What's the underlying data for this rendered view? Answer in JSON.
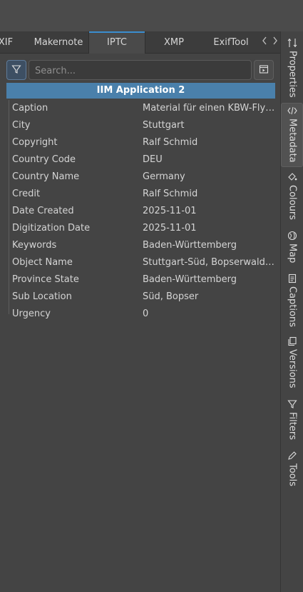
{
  "tabs": [
    {
      "label": "XIF",
      "active": false
    },
    {
      "label": "Makernote",
      "active": false
    },
    {
      "label": "IPTC",
      "active": true
    },
    {
      "label": "XMP",
      "active": false
    },
    {
      "label": "ExifTool",
      "active": false
    }
  ],
  "search": {
    "placeholder": "Search..."
  },
  "section_header": "IIM Application 2",
  "rows": [
    {
      "key": "Caption",
      "value": "Material für einen KBW-Flyer..."
    },
    {
      "key": "City",
      "value": "Stuttgart"
    },
    {
      "key": "Copyright",
      "value": "Ralf Schmid"
    },
    {
      "key": "Country Code",
      "value": "DEU"
    },
    {
      "key": "Country Name",
      "value": "Germany"
    },
    {
      "key": "Credit",
      "value": "Ralf Schmid"
    },
    {
      "key": "Date Created",
      "value": "2025-11-01"
    },
    {
      "key": "Digitization Date",
      "value": "2025-11-01"
    },
    {
      "key": "Keywords",
      "value": "Baden-Württemberg"
    },
    {
      "key": "Object Name",
      "value": "Stuttgart-Süd, Bopserwaldstr..."
    },
    {
      "key": "Province State",
      "value": "Baden-Württemberg"
    },
    {
      "key": "Sub Location",
      "value": "Süd, Bopser"
    },
    {
      "key": "Urgency",
      "value": "0"
    }
  ],
  "sidebar": [
    {
      "label": "Properties",
      "icon": "properties-icon",
      "active": false
    },
    {
      "label": "Metadata",
      "icon": "code-icon",
      "active": true
    },
    {
      "label": "Colours",
      "icon": "paint-bucket-icon",
      "active": false
    },
    {
      "label": "Map",
      "icon": "globe-icon",
      "active": false
    },
    {
      "label": "Captions",
      "icon": "document-icon",
      "active": false
    },
    {
      "label": "Versions",
      "icon": "versions-icon",
      "active": false
    },
    {
      "label": "Filters",
      "icon": "funnel-icon",
      "active": false
    },
    {
      "label": "Tools",
      "icon": "pencil-icon",
      "active": false
    }
  ],
  "colors": {
    "accent": "#3b8ed0",
    "header_bg": "#4a80ab",
    "background": "#434343"
  }
}
